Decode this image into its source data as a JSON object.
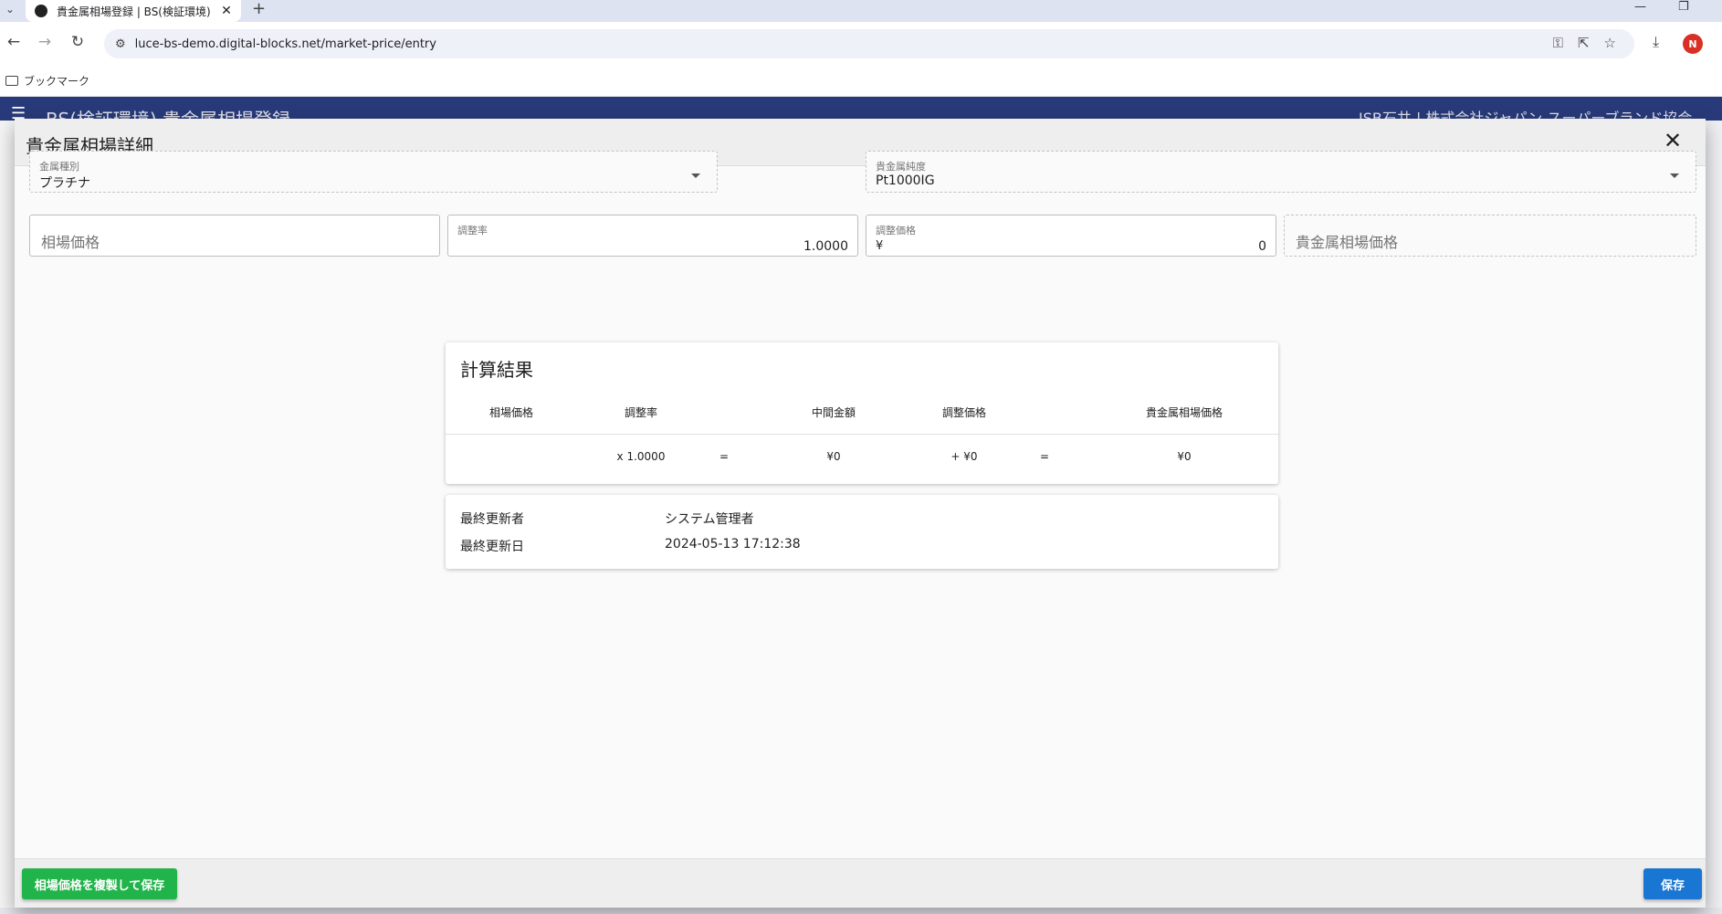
{
  "browser": {
    "tab_title": "貴金属相場登録 | BS(検証環境)",
    "tab_close": "✕",
    "new_tab": "+",
    "url": "luce-bs-demo.digital-blocks.net/market-price/entry",
    "bookmarks_label": "ブックマーク",
    "avatar_letter": "N"
  },
  "app": {
    "title": "BS(検証環境) 貴金属相場登録",
    "user": "JSB石井 | 株式会社ジャパン スーパーブランド協会"
  },
  "dialog": {
    "title": "貴金属相場詳細",
    "close_icon": "✕",
    "metal_type": {
      "label": "金属種別",
      "value": "プラチナ"
    },
    "purity": {
      "label": "貴金属純度",
      "value": "Pt1000IG"
    },
    "market_price": {
      "placeholder": "相場価格"
    },
    "adjust_rate": {
      "label": "調整率",
      "value": "1.0000"
    },
    "adjust_price": {
      "label": "調整価格",
      "prefix": "¥",
      "value": "0"
    },
    "metal_market_price": {
      "placeholder": "貴金属相場価格"
    },
    "calc": {
      "title": "計算結果",
      "headers": {
        "market_price": "相場価格",
        "rate": "調整率",
        "intermediate": "中間金額",
        "adjust": "調整価格",
        "result": "貴金属相場価格"
      },
      "row": {
        "rate": "x 1.0000",
        "eq1": "=",
        "intermediate": "¥0",
        "adjust": "+ ¥0",
        "eq2": "=",
        "result": "¥0"
      }
    },
    "info": {
      "updater_label": "最終更新者",
      "updater_value": "システム管理者",
      "updated_label": "最終更新日",
      "updated_value": "2024-05-13 17:12:38"
    },
    "footer": {
      "copy_save": "相場価格を複製して保存",
      "save": "保存"
    }
  }
}
